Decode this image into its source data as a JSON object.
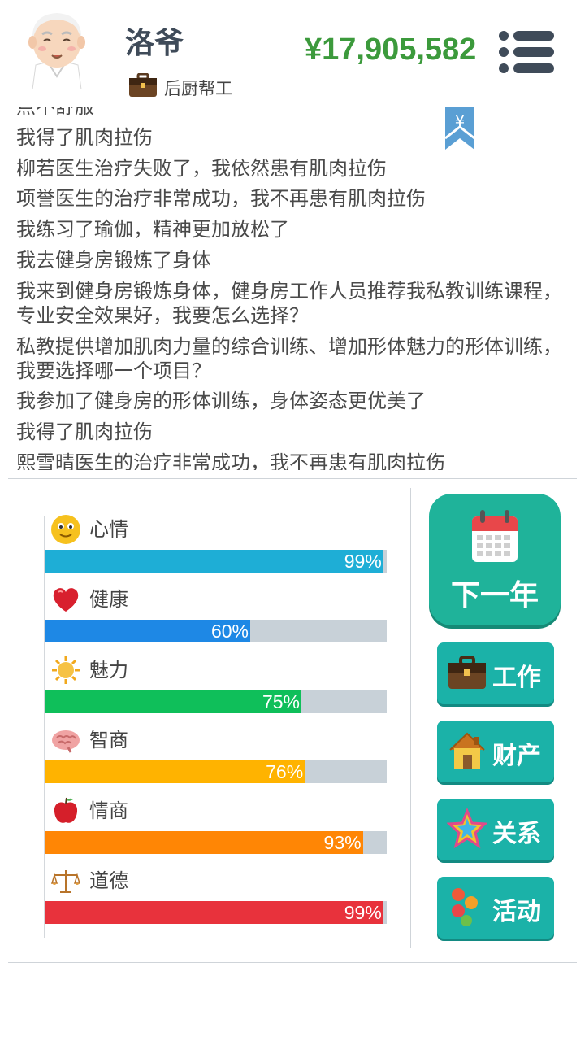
{
  "header": {
    "name": "洛爷",
    "job": "后厨帮工",
    "money": "¥17,905,582"
  },
  "log": {
    "lines": [
      "点不舒服",
      "我得了肌肉拉伤",
      "柳若医生治疗失败了，我依然患有肌肉拉伤",
      "项誉医生的治疗非常成功，我不再患有肌肉拉伤",
      "我练习了瑜伽，精神更加放松了",
      "我去健身房锻炼了身体",
      "我来到健身房锻炼身体，健身房工作人员推荐我私教训练课程，专业安全效果好，我要怎么选择？",
      "私教提供增加肌肉力量的综合训练、增加形体魅力的形体训练，我要选择哪一个项目？",
      "我参加了健身房的形体训练，身体姿态更优美了",
      "我得了肌肉拉伤",
      "熙雪晴医生的治疗非常成功，我不再患有肌肉拉伤"
    ],
    "bookmark_symbol": "¥"
  },
  "stats": [
    {
      "label": "心情",
      "value": 99,
      "pct_text": "99%",
      "color": "#1eaed6",
      "icon": "smiley-icon"
    },
    {
      "label": "健康",
      "value": 60,
      "pct_text": "60%",
      "color": "#1e88e5",
      "icon": "heart-icon"
    },
    {
      "label": "魅力",
      "value": 75,
      "pct_text": "75%",
      "color": "#0fbf5a",
      "icon": "sun-icon"
    },
    {
      "label": "智商",
      "value": 76,
      "pct_text": "76%",
      "color": "#ffb300",
      "icon": "brain-icon"
    },
    {
      "label": "情商",
      "value": 93,
      "pct_text": "93%",
      "color": "#ff8605",
      "icon": "apple-icon"
    },
    {
      "label": "道德",
      "value": 99,
      "pct_text": "99%",
      "color": "#e8323c",
      "icon": "scales-icon"
    }
  ],
  "buttons": {
    "next_year": "下一年",
    "work": "工作",
    "property": "财产",
    "relations": "关系",
    "activities": "活动"
  }
}
